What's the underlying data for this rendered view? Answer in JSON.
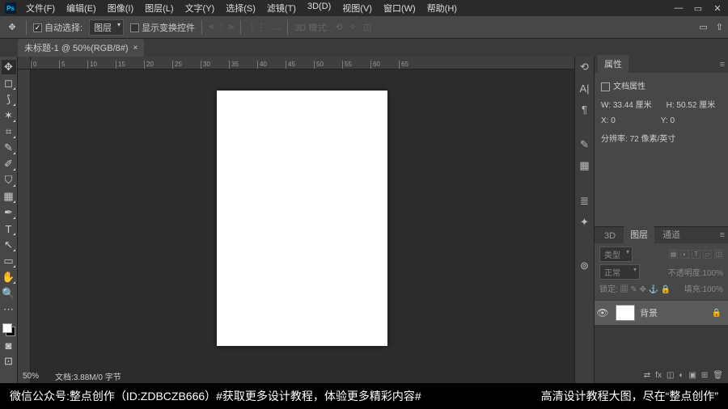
{
  "menu": [
    "文件(F)",
    "编辑(E)",
    "图像(I)",
    "图层(L)",
    "文字(Y)",
    "选择(S)",
    "滤镜(T)",
    "3D(D)",
    "视图(V)",
    "窗口(W)",
    "帮助(H)"
  ],
  "options": {
    "auto_select": "自动选择:",
    "auto_select_mode": "图层",
    "show_transform": "显示变换控件",
    "mode3d": "3D 模式:"
  },
  "tab": {
    "title": "未标题-1 @ 50%(RGB/8#)"
  },
  "ruler_ticks": [
    "0",
    "5",
    "10",
    "15",
    "20",
    "25",
    "30",
    "35",
    "40",
    "45",
    "50",
    "55",
    "60",
    "65"
  ],
  "properties": {
    "panel_label": "属性",
    "doc_label": "文档属性",
    "w_label": "W:",
    "w_val": "33.44 厘米",
    "h_label": "H:",
    "h_val": "50.52 厘米",
    "x_label": "X:",
    "x_val": "0",
    "y_label": "Y:",
    "y_val": "0",
    "res_label": "分辨率:",
    "res_val": "72 像素/英寸"
  },
  "layers_panel": {
    "tabs": [
      "3D",
      "图层",
      "通道"
    ],
    "kind": "类型",
    "blend": "正常",
    "opacity_label": "不透明度:",
    "opacity_val": "100%",
    "lock_label": "锁定:",
    "fill_label": "填充:",
    "fill_val": "100%",
    "layer_name": "背景"
  },
  "status": {
    "zoom": "50%",
    "docinfo": "文档:3.88M/0 字节"
  },
  "footer": {
    "left": "微信公众号:整点创作（ID:ZDBCZB666）#获取更多设计教程，体验更多精彩内容#",
    "right": "高清设计教程大图，尽在“整点创作”"
  }
}
